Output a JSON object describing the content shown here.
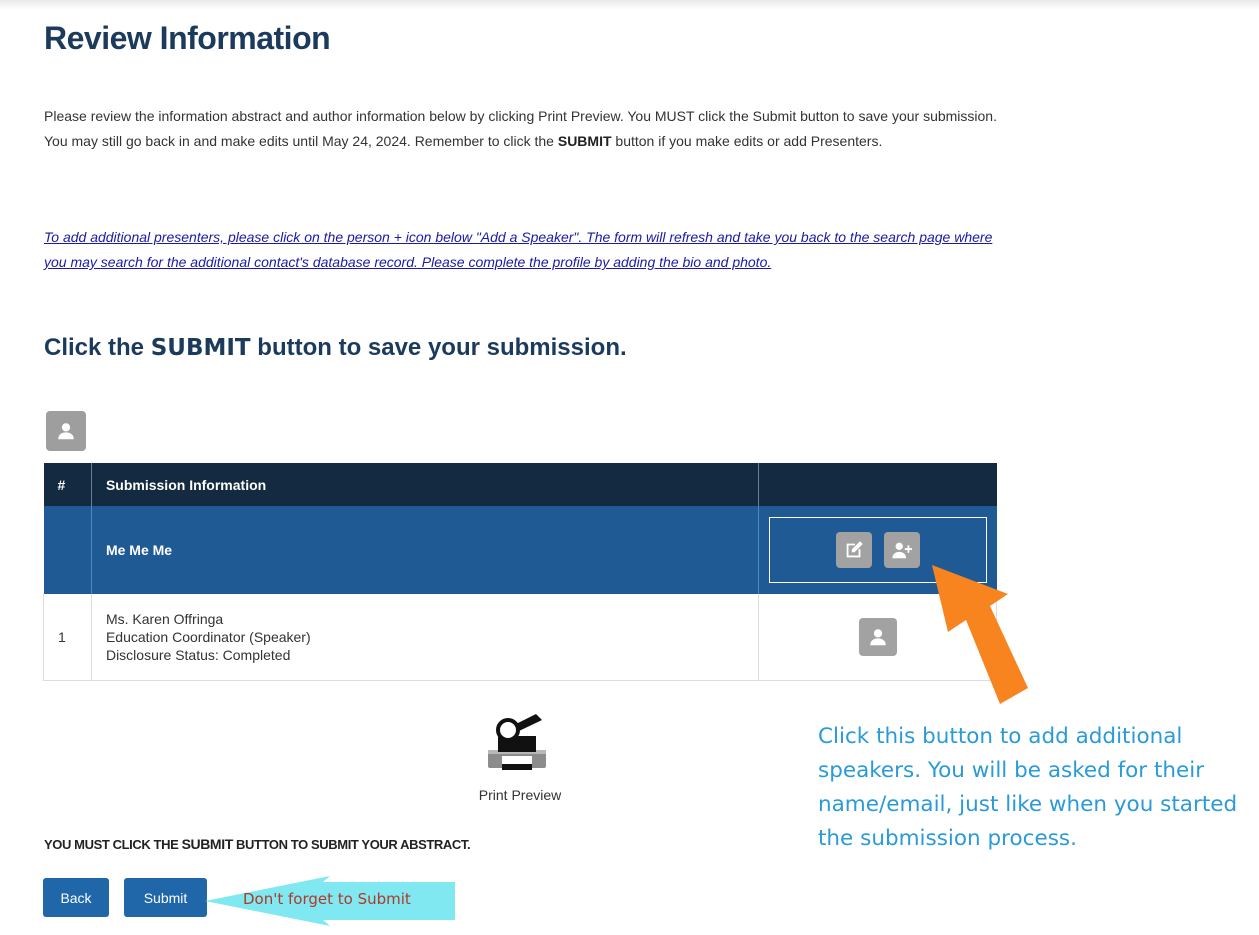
{
  "page": {
    "title": "Review Information",
    "intro": {
      "part1": "Please review the information abstract and author information below by clicking Print Preview. You MUST click the Submit button to save your submission. You may still go back in and make edits until May 24, 2024. Remember to click the ",
      "bold": "SUBMIT",
      "part2": " button if you make edits or add Presenters."
    },
    "note": "To add additional presenters, please click on the person + icon below \"Add a Speaker\". The form will refresh and take you back to the search page where you may search for the additional contact's database record. Please complete the profile by adding the bio and photo.",
    "subhead": {
      "pre": "Click the ",
      "big": "SUBMIT",
      "post": " button to save your submission."
    }
  },
  "table": {
    "headers": [
      "#",
      "Submission Information",
      ""
    ],
    "group_title": "Me Me Me",
    "rows": [
      {
        "num": "1",
        "name": "Ms. Karen Offringa",
        "role": "Education Coordinator (Speaker)",
        "status": "Disclosure Status: Completed"
      }
    ]
  },
  "print": {
    "label": "Print Preview"
  },
  "footer": {
    "must_pre": "YOU MUST CLICK THE ",
    "must_bold": "SUBMIT",
    "must_post": " BUTTON TO SUBMIT YOUR ABSTRACT.",
    "back_label": "Back",
    "submit_label": "Submit"
  },
  "annotations": {
    "left": "Don't forget to Submit",
    "right": "Click this button to add additional speakers. You will be asked for their name/email, just like when you started the submission process."
  },
  "icons": {
    "person": "person-icon",
    "edit": "edit-icon",
    "add_person": "add-person-icon",
    "print": "print-preview-icon"
  },
  "colors": {
    "title": "#1b3a5c",
    "header_bg": "#132a40",
    "group_bg": "#1f5a94",
    "button_bg": "#1f67a9",
    "orange_arrow": "#f7841f",
    "cyan_arrow": "#7fe8f0",
    "right_text": "#2a9ad8",
    "left_text": "#b1382a"
  }
}
